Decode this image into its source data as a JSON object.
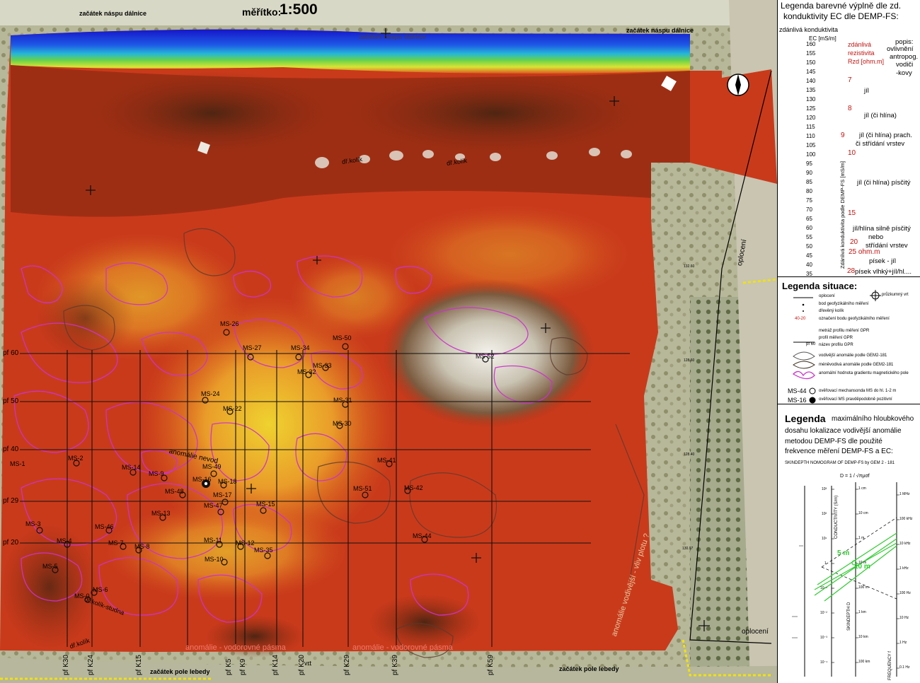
{
  "header": {
    "scale_label": "měřítko:",
    "scale_value": "1:500",
    "top_left_note": "začátek náspu dálnice",
    "top_right_note": "začátek náspu dálnice",
    "bottom_left_note": "začátek pole lebedy",
    "bottom_right_note": "začátek pole lebedy",
    "top_ghost_note": "začátek náspu dálnice"
  },
  "map_labels": {
    "fence_right": "oplocení",
    "fence_bottom": "oplocení",
    "anomaly_right": "anomálie vodivější - vliv plotu ?",
    "anomaly_nevod": "anomálie nevod",
    "stake1": "dř.kolík",
    "stake2": "dř.kolík",
    "stake_well": "dř.kolík-studna",
    "stake_bottom": "dř.kolík",
    "bottom_anomaly1": "anomálie - vodorovné pásma",
    "bottom_anomaly2": "anomálie - vodorovné pásma",
    "borehole": "vrt",
    "coord_label": "132.60",
    "coord_label2": "128.60",
    "coord_label3": "128.40",
    "coord_label4": "130.97"
  },
  "profiles_horizontal": [
    {
      "label": "pf 60"
    },
    {
      "label": "pf 50"
    },
    {
      "label": "pf 40"
    },
    {
      "label": "pf 29"
    },
    {
      "label": "pf 20"
    }
  ],
  "profiles_vertical": [
    {
      "label": "pf K30"
    },
    {
      "label": "pf K24"
    },
    {
      "label": "pf K15"
    },
    {
      "label": "pf K5"
    },
    {
      "label": "pf K9"
    },
    {
      "label": "pf K14"
    },
    {
      "label": "pf K20"
    },
    {
      "label": "pf K29"
    },
    {
      "label": "pf K39"
    },
    {
      "label": "pf K59"
    }
  ],
  "probes": [
    {
      "label": "MS-26"
    },
    {
      "label": "MS-50"
    },
    {
      "label": "MS-27"
    },
    {
      "label": "MS-34"
    },
    {
      "label": "MS-52"
    },
    {
      "label": "MS-33"
    },
    {
      "label": "MS-32"
    },
    {
      "label": "MS-24"
    },
    {
      "label": "MS-31"
    },
    {
      "label": "MS-22"
    },
    {
      "label": "MS-30"
    },
    {
      "label": "MS-1"
    },
    {
      "label": "MS-2"
    },
    {
      "label": "MS-14"
    },
    {
      "label": "MS-9"
    },
    {
      "label": "MS-49"
    },
    {
      "label": "MS-16"
    },
    {
      "label": "MS-18"
    },
    {
      "label": "MS-41"
    },
    {
      "label": "MS-48"
    },
    {
      "label": "MS-17"
    },
    {
      "label": "MS-51"
    },
    {
      "label": "MS-42"
    },
    {
      "label": "MS-47"
    },
    {
      "label": "MS-15"
    },
    {
      "label": "MS-13"
    },
    {
      "label": "MS-3"
    },
    {
      "label": "MS-46"
    },
    {
      "label": "MS-44"
    },
    {
      "label": "MS-4"
    },
    {
      "label": "MS-7"
    },
    {
      "label": "MS-8"
    },
    {
      "label": "MS-11"
    },
    {
      "label": "MS-12"
    },
    {
      "label": "MS-10"
    },
    {
      "label": "MS-35"
    },
    {
      "label": "MS-5"
    },
    {
      "label": "MS-6"
    },
    {
      "label": "MS-0"
    }
  ],
  "legend_color": {
    "title1": "Legenda barevné výplně dle zd.",
    "title2": "konduktivity EC dle DEMP-FS:",
    "subtitle": "zdánlivá konduktivita",
    "ec_header": "EC [mS/m]",
    "axis_label": "Zdánlivá konduktivita podle DEMP-FS [mS/m]",
    "ticks": [
      "160",
      "155",
      "150",
      "145",
      "140",
      "135",
      "130",
      "125",
      "120",
      "115",
      "110",
      "105",
      "100",
      "95",
      "90",
      "85",
      "80",
      "75",
      "70",
      "65",
      "60",
      "55",
      "50",
      "45",
      "40",
      "35"
    ],
    "rzd_header1": "zdánlivá",
    "rzd_header2": "rezistivita",
    "rzd_header3": "Rzd [ohm.m]",
    "rzd_values": [
      "7",
      "8",
      "9",
      "10",
      "15",
      "20",
      "25 ohm.m",
      "28"
    ],
    "descr_header": "popis:",
    "descriptions": [
      "ovlivnění",
      "antropog.",
      "vodiči",
      "-kovy",
      "jíl",
      "jíl (či hlína)",
      "jíl (či hlína) prach.",
      "či střídání vrstev",
      "jíl (či hlína) písčitý",
      "jíl/hlína silně písčitý",
      "nebo",
      "střídání vrstev",
      "písek - jíl",
      "písek vlhký+jíl/hl...."
    ]
  },
  "legend_situation": {
    "title": "Legenda situace:",
    "items": [
      "oplocení",
      "bod geofyzikálního měření",
      "dřevěný kolík",
      "označení bodu geofyzikálního měření",
      "metráž profilu měření GPR",
      "profil měření GPR",
      "název profilu GPR",
      "vodivější anomálie podle GEM2-181",
      "méněvodivá anomálie podle GEM2-181",
      "anomální hodnota gradientu magnetického pole",
      "ověřovací mechansonda MS do hl. 1-2 m",
      "ověřovací MS pravděpodobně pozitivní"
    ],
    "borehole_item": "průzkumný vrt",
    "sym_profile_metric": "40-20",
    "sym_profile_name": "pf 60",
    "sym_ms44": "MS-44",
    "sym_ms16": "MS-16"
  },
  "legend_depth": {
    "title_big": "Legenda",
    "title_rest1": "maximálního hloubkového",
    "title_rest2": "dosahu lokalizace vodivější anomálie",
    "title_rest3": "metodou DEMP-FS dle použité",
    "title_rest4": "frekvence měření DEMP-FS a EC:",
    "nomogram_title": "SKINDEPTH NOMOGRAM OF DEMP-FS by GEM 2 - 181",
    "formula": "D = 1 / √πμσf",
    "axis_conductivity": "CONDUCTIVITY (S/m)",
    "axis_skindepth": "SKINDEPTH D",
    "axis_frequency": "FREQUENCY f",
    "mark_5m": "5 m",
    "mark_10m": "10 m",
    "depth_ticks": [
      "1 cm",
      "10 cm",
      "1 m",
      "10 m",
      "100 m",
      "1 km",
      "10 km",
      "100 km"
    ],
    "freq_ticks": [
      "1 MHz",
      "100 kHz",
      "10 kHz",
      "1 kHz",
      "100 Hz",
      "10 Hz",
      "1 Hz",
      "0.1 Hz"
    ],
    "cond_ticks": [
      "10³",
      "10²",
      "10¹",
      "1",
      "10⁻¹",
      "10⁻²",
      "10⁻³",
      "10⁻⁴"
    ]
  },
  "colors": {
    "accent_red": "#c0140f",
    "magenta": "#cc33cc",
    "nomogram_green": "#2ecc2e"
  }
}
